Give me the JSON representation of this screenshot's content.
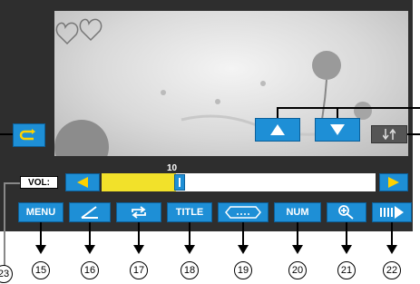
{
  "volume": {
    "label": "VOL:",
    "value": "10",
    "level": 0.27
  },
  "buttons": {
    "menu": "MENU",
    "title": "TITLE",
    "num": "NUM"
  },
  "callouts": [
    "15",
    "16",
    "17",
    "18",
    "19",
    "20",
    "21",
    "22",
    "23"
  ],
  "icons": {
    "repeat": "repeat-icon",
    "up": "up-arrow-icon",
    "down": "down-arrow-icon",
    "toggle": "toggle-icon",
    "vol_left": "left-arrow-icon",
    "vol_right": "right-arrow-icon",
    "aspect": "aspect-ratio-icon",
    "ab_repeat": "repeat-loop-icon",
    "enter_digits": "digits-entry-icon",
    "zoom": "zoom-icon",
    "step": "step-forward-icon"
  },
  "colors": {
    "accent": "#1e8fd6",
    "panel": "#2e2e2e",
    "volume_fill": "#f2e12a",
    "arrow_yellow": "#ffd200"
  }
}
